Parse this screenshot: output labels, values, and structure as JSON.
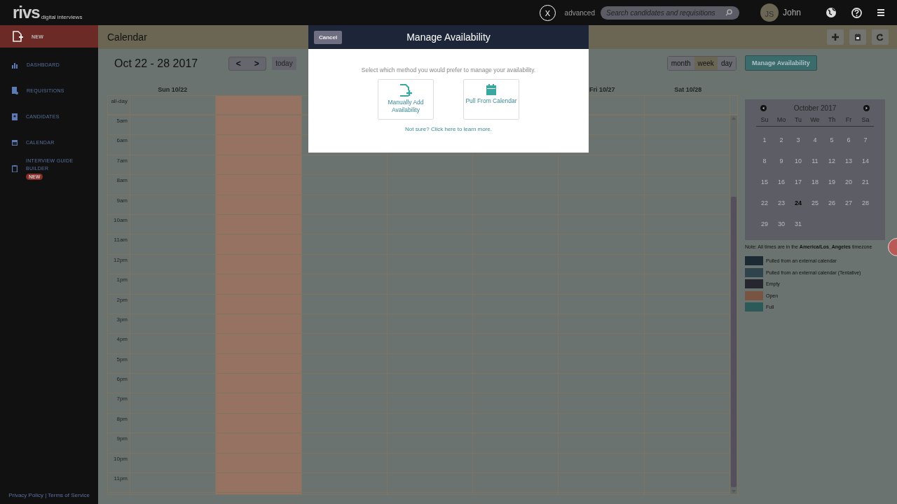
{
  "topbar": {
    "logo": "rivs",
    "logo_tagline": "digital interviews",
    "advanced_link": "advanced",
    "search": {
      "placeholder": "Search candidates and requisitions"
    },
    "avatar_initials": "JS",
    "user_name": "John"
  },
  "sidebar": {
    "items": [
      {
        "label": "NEW",
        "kind": "new",
        "selected": true
      },
      {
        "label": "DASHBOARD",
        "kind": "chart",
        "selected": false
      },
      {
        "label": "REQUISITIONS",
        "kind": "doc",
        "selected": false
      },
      {
        "label": "CANDIDATES",
        "kind": "person",
        "selected": false
      },
      {
        "label": "CALENDAR",
        "kind": "calendar",
        "selected": false
      },
      {
        "label": "INTERVIEW GUIDE BUILDER",
        "kind": "clipboard",
        "selected": false,
        "badge": "NEW"
      }
    ],
    "footer": "Privacy Policy | Terms of Service"
  },
  "page_header": {
    "title": "Calendar"
  },
  "toolbar": {
    "range": "Oct 22 - 28 2017",
    "prev": "<",
    "next": ">",
    "today": "today",
    "views": [
      {
        "label": "month",
        "selected": false
      },
      {
        "label": "week",
        "selected": true
      },
      {
        "label": "day",
        "selected": false
      }
    ],
    "manage_button": "Manage Availability"
  },
  "calendar": {
    "days": [
      {
        "label": "Sun 10/22",
        "open": false
      },
      {
        "open": true
      },
      {
        "open": false
      },
      {
        "open": false
      },
      {
        "open": false
      },
      {
        "label": "Fri 10/27",
        "open": false
      },
      {
        "label": "Sat 10/28",
        "open": false
      }
    ],
    "all_day_label": "all-day",
    "hours": [
      "5am",
      "6am",
      "7am",
      "8am",
      "9am",
      "10am",
      "11am",
      "12pm",
      "1pm",
      "2pm",
      "3pm",
      "4pm",
      "5pm",
      "6pm",
      "7pm",
      "8pm",
      "9pm",
      "10pm",
      "11pm"
    ]
  },
  "mini_calendar": {
    "month": "October 2017",
    "weekdays": [
      "Su",
      "Mo",
      "Tu",
      "We",
      "Th",
      "Fr",
      "Sa"
    ],
    "weeks": [
      [
        {
          "day": "1",
          "today": false
        },
        {
          "day": "2",
          "today": false
        },
        {
          "day": "3",
          "today": false
        },
        {
          "day": "4",
          "today": false
        },
        {
          "day": "5",
          "today": false
        },
        {
          "day": "6",
          "today": false
        },
        {
          "day": "7",
          "today": false
        }
      ],
      [
        {
          "day": "8",
          "today": false
        },
        {
          "day": "9",
          "today": false
        },
        {
          "day": "10",
          "today": false
        },
        {
          "day": "11",
          "today": false
        },
        {
          "day": "12",
          "today": false
        },
        {
          "day": "13",
          "today": false
        },
        {
          "day": "14",
          "today": false
        }
      ],
      [
        {
          "day": "15",
          "today": false
        },
        {
          "day": "16",
          "today": false
        },
        {
          "day": "17",
          "today": false
        },
        {
          "day": "18",
          "today": false
        },
        {
          "day": "19",
          "today": false
        },
        {
          "day": "20",
          "today": false
        },
        {
          "day": "21",
          "today": false
        }
      ],
      [
        {
          "day": "22",
          "today": false
        },
        {
          "day": "23",
          "today": false
        },
        {
          "day": "24",
          "today": true
        },
        {
          "day": "25",
          "today": false
        },
        {
          "day": "26",
          "today": false
        },
        {
          "day": "27",
          "today": false
        },
        {
          "day": "28",
          "today": false
        }
      ],
      [
        {
          "day": "29",
          "today": false
        },
        {
          "day": "30",
          "today": false
        },
        {
          "day": "31",
          "today": false
        }
      ]
    ]
  },
  "timezone_note": "Note: All times are in the **America/Los_Angeles** timezone",
  "legend": [
    {
      "label": "Pulled from an external calendar",
      "color": "#1c2a33"
    },
    {
      "label": "Pulled from an external calendar (Tentative)",
      "color": "#2e434b"
    },
    {
      "label": "Empty",
      "color": "#262630"
    },
    {
      "label": "Open",
      "color": "#7a5443"
    },
    {
      "label": "Full",
      "color": "#2b5a58"
    }
  ],
  "modal": {
    "title": "Manage Availability",
    "cancel": "Cancel",
    "close": "X",
    "prompt": "Select which method you would prefer to manage your availability.",
    "options": [
      {
        "label": "Manually Add Availability",
        "kind": "manual"
      },
      {
        "label": "Pull From Calendar",
        "kind": "pull"
      }
    ],
    "help_link": "Not sure? Click here to learn more."
  }
}
